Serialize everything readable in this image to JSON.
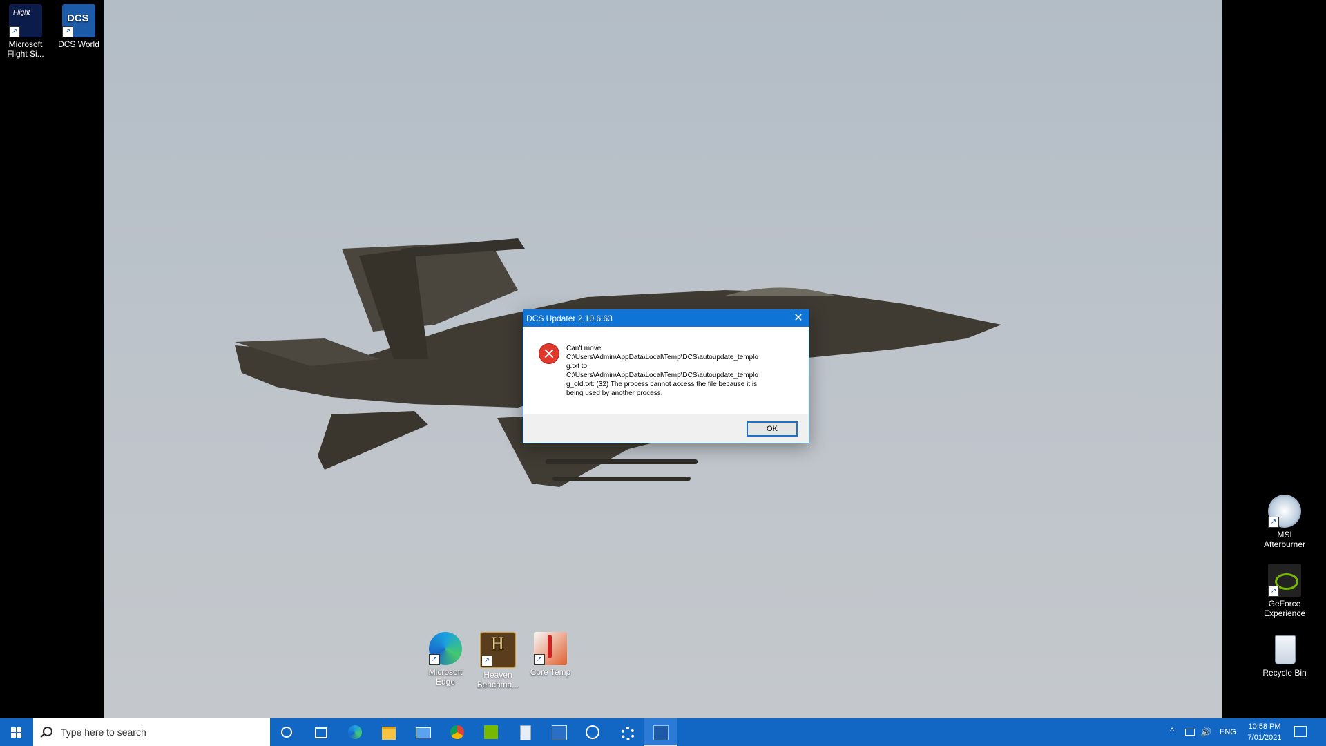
{
  "desktop": {
    "left_icons": [
      {
        "label": "Microsoft Flight Si...",
        "icon": "flight-simulator-icon"
      },
      {
        "label": "DCS World",
        "icon": "dcs-icon"
      }
    ],
    "bottom_icons": [
      {
        "label": "Microsoft Edge",
        "icon": "edge-icon"
      },
      {
        "label": "Heaven Benchma...",
        "icon": "heaven-benchmark-icon"
      },
      {
        "label": "Core Temp",
        "icon": "core-temp-icon"
      }
    ],
    "right_icons": [
      {
        "label": "MSI Afterburner",
        "icon": "msi-afterburner-icon"
      },
      {
        "label": "GeForce Experience",
        "icon": "geforce-icon"
      },
      {
        "label": "Recycle Bin",
        "icon": "recycle-bin-icon"
      }
    ]
  },
  "dialog": {
    "title": "DCS Updater 2.10.6.63",
    "close_glyph": "✕",
    "message": "Can't move\nC:\\Users\\Admin\\AppData\\Local\\Temp\\DCS\\autoupdate_templo\ng.txt to\nC:\\Users\\Admin\\AppData\\Local\\Temp\\DCS\\autoupdate_templo\ng_old.txt: (32) The process cannot access the file because it is\nbeing used by another process.",
    "ok_label": "OK"
  },
  "taskbar": {
    "search_placeholder": "Type here to search",
    "pinned": [
      "cortana-icon",
      "task-view-icon",
      "edge-icon",
      "file-explorer-icon",
      "mail-icon",
      "chrome-icon",
      "nvidia-icon",
      "notepad-icon",
      "outlook-icon",
      "xbox-icon",
      "settings-icon",
      "dcs-icon"
    ],
    "language": "ENG",
    "time": "10:58 PM",
    "date": "7/01/2021"
  }
}
